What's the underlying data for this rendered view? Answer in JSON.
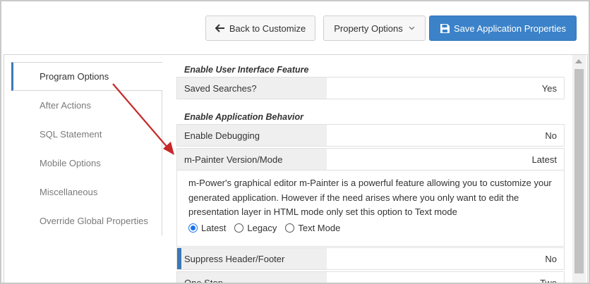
{
  "toolbar": {
    "back_label": "Back to Customize",
    "property_options_label": "Property Options",
    "save_label": "Save Application Properties"
  },
  "sidebar": {
    "items": [
      {
        "label": "Program Options",
        "active": true
      },
      {
        "label": "After Actions"
      },
      {
        "label": "SQL Statement"
      },
      {
        "label": "Mobile Options"
      },
      {
        "label": "Miscellaneous"
      },
      {
        "label": "Override Global Properties"
      }
    ]
  },
  "sections": {
    "ui_feature": {
      "title": "Enable User Interface Feature",
      "rows": [
        {
          "label": "Saved Searches?",
          "value": "Yes"
        }
      ]
    },
    "app_behavior": {
      "title": "Enable Application Behavior",
      "rows": [
        {
          "label": "Enable Debugging",
          "value": "No"
        },
        {
          "label": "m-Painter Version/Mode",
          "value": "Latest"
        },
        {
          "label": "Suppress Header/Footer",
          "value": "No"
        },
        {
          "label": "One Step",
          "value": "Two"
        }
      ]
    }
  },
  "mpainter": {
    "description": "m-Power's graphical editor m-Painter is a powerful feature allowing you to customize your generated application. However if the need arises where you only want to edit the presentation layer in HTML mode only set this option to Text mode",
    "options": [
      "Latest",
      "Legacy",
      "Text Mode"
    ],
    "selected": "Latest"
  },
  "colors": {
    "primary_button": "#3b82c9",
    "active_marker": "#3b78b5",
    "annotation_arrow": "#c62828"
  }
}
